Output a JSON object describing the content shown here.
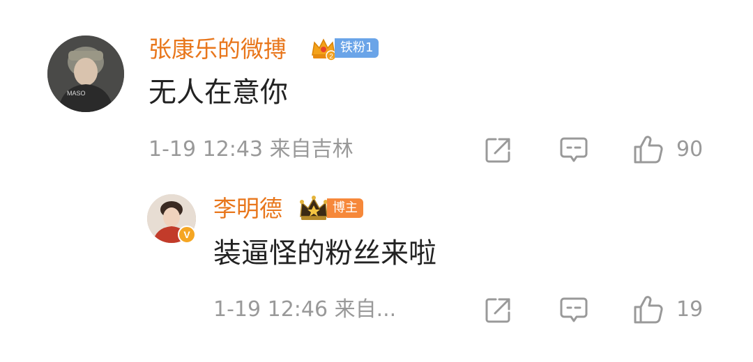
{
  "comments": [
    {
      "username": "张康乐的微搏",
      "badge_label": "铁粉1",
      "text": "无人在意你",
      "meta": "1-19 12:43 来自吉林",
      "likes": "90"
    },
    {
      "username": "李明德",
      "badge_label": "博主",
      "verified_mark": "V",
      "text": "装逼怪的粉丝来啦",
      "meta": "1-19 12:46 来自...",
      "likes": "19"
    }
  ],
  "colors": {
    "username": "#e8761b",
    "text": "#222222",
    "meta": "#999999",
    "fan_badge": "#6aa4e8",
    "host_badge": "#f6883a"
  },
  "icons": [
    "share-icon",
    "comment-icon",
    "like-icon"
  ]
}
